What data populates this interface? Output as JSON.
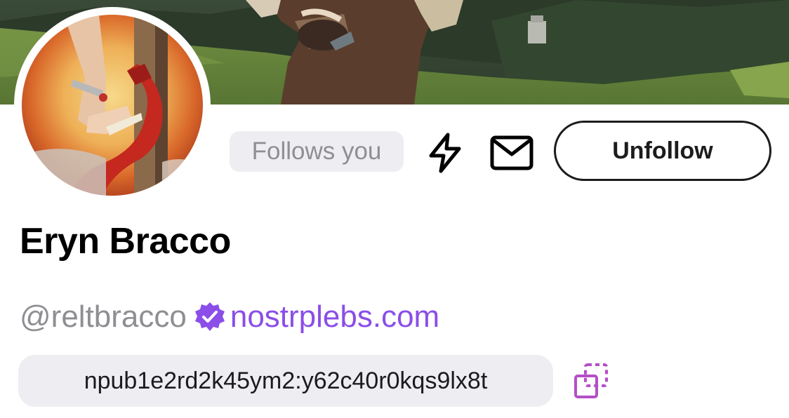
{
  "profile": {
    "display_name": "Eryn Bracco",
    "handle": "@reltbracco",
    "nip05_domain": "nostrplebs.com",
    "npub": "npub1e2rd2k45ym2:y62c40r0kqs9lx8t",
    "follows_you_label": "Follows you"
  },
  "actions": {
    "unfollow_label": "Unfollow",
    "zap_icon": "lightning-bolt-icon",
    "message_icon": "envelope-icon",
    "copy_icon": "copy-icon"
  },
  "badges": {
    "verified_icon": "verified-badge-icon"
  },
  "colors": {
    "accent": "#8b4ee8",
    "muted_text": "#8e8e93",
    "pill_background": "#eeeef2",
    "copy_icon": "#b54fc6"
  }
}
